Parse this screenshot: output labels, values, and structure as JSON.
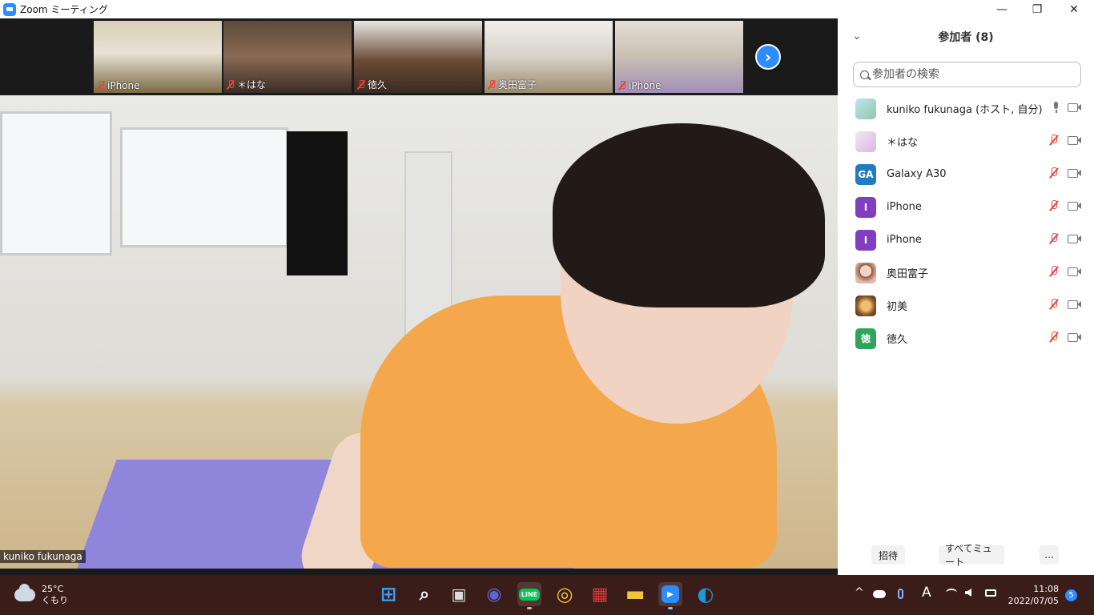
{
  "window": {
    "title": "Zoom ミーティング",
    "controls": {
      "minimize": "—",
      "restore": "❐",
      "close": "✕"
    }
  },
  "thumbnails": [
    {
      "name": "iPhone"
    },
    {
      "name": "＊はな"
    },
    {
      "name": "徳久"
    },
    {
      "name": "奥田富子"
    },
    {
      "name": "iPhone"
    }
  ],
  "next_button": "›",
  "main_video": {
    "speaker": "kuniko fukunaga"
  },
  "participants_panel": {
    "collapse": "⌄",
    "title": "参加者 (8)",
    "search_placeholder": "参加者の検索",
    "participants": [
      {
        "initials": "",
        "name": "kuniko fukunaga (ホスト, 自分)",
        "muted": false,
        "avatar_color": "#a8d8e8"
      },
      {
        "initials": "",
        "name": "＊はな",
        "muted": true,
        "avatar_color": "#e9d3ef"
      },
      {
        "initials": "GA",
        "name": "Galaxy A30",
        "muted": true,
        "avatar_color": "#1f7dbf"
      },
      {
        "initials": "I",
        "name": "iPhone",
        "muted": true,
        "avatar_color": "#7f3fbf"
      },
      {
        "initials": "I",
        "name": "iPhone",
        "muted": true,
        "avatar_color": "#7f3fbf"
      },
      {
        "initials": "",
        "name": "奥田富子",
        "muted": true,
        "avatar_color": "#e7b7a8"
      },
      {
        "initials": "",
        "name": "初美",
        "muted": true,
        "avatar_color": "#b07a3a"
      },
      {
        "initials": "徳",
        "name": "徳久",
        "muted": true,
        "avatar_color": "#2ea55a"
      }
    ],
    "footer": {
      "invite": "招待",
      "mute_all": "すべてミュート",
      "more": "..."
    }
  },
  "taskbar": {
    "weather": {
      "temp": "25°C",
      "condition": "くもり"
    },
    "apps": [
      {
        "name": "start",
        "glyph": "⊞",
        "color": "#3aa0ff"
      },
      {
        "name": "search",
        "glyph": "⌕",
        "color": "transparent"
      },
      {
        "name": "task-view",
        "glyph": "▣",
        "color": "transparent"
      },
      {
        "name": "teams-chat",
        "glyph": "◉",
        "color": "#6264d6"
      },
      {
        "name": "line",
        "glyph": "LINE",
        "color": "#06c755"
      },
      {
        "name": "chrome",
        "glyph": "◎",
        "color": "#dd4b39"
      },
      {
        "name": "gift",
        "glyph": "▦",
        "color": "#e03a3a"
      },
      {
        "name": "file-explorer",
        "glyph": "▬",
        "color": "#f2c43a"
      },
      {
        "name": "zoom",
        "glyph": "▶",
        "color": "#2d8cff"
      },
      {
        "name": "edge",
        "glyph": "◐",
        "color": "#1b9ad8"
      }
    ],
    "tray": {
      "chevron": "^",
      "ime": "A"
    },
    "clock": {
      "time": "11:08",
      "date": "2022/07/05"
    },
    "notifications": "5"
  }
}
